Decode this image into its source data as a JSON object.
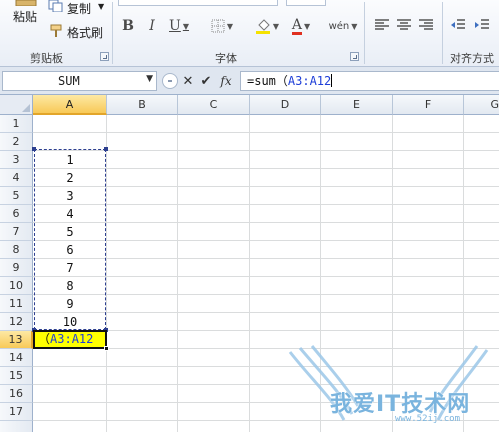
{
  "ribbon": {
    "clipboard": {
      "paste_label": "粘贴",
      "copy_label": "复制",
      "format_painter_label": "格式刷",
      "group_label": "剪贴板"
    },
    "font": {
      "bold": "B",
      "italic": "I",
      "underline": "U",
      "font_color_glyph": "A",
      "phonetic_glyph": "wén",
      "group_label": "字体"
    },
    "alignment": {
      "group_label": "对齐方式"
    }
  },
  "formula_bar": {
    "name_box": "SUM",
    "cancel_glyph": "✕",
    "enter_glyph": "✔",
    "fx_glyph": "fx",
    "formula_prefix": "=sum（",
    "formula_ref": "A3:A12"
  },
  "grid": {
    "columns": [
      "A",
      "B",
      "C",
      "D",
      "E",
      "F",
      "G"
    ],
    "rows": [
      "1",
      "2",
      "3",
      "4",
      "5",
      "6",
      "7",
      "8",
      "9",
      "10",
      "11",
      "12",
      "13",
      "14",
      "15",
      "16",
      "17"
    ],
    "active_column": "A",
    "active_row": "13",
    "cells": [
      "1",
      "2",
      "3",
      "4",
      "5",
      "6",
      "7",
      "8",
      "9",
      "10"
    ],
    "editing_cell_prefix": "（",
    "editing_cell_ref": "A3:A12"
  },
  "watermark": {
    "text": "我爱IT技术网",
    "url": "www.52ij.com"
  },
  "colors": {
    "ribbon_bg": "#e9eef6",
    "header_active": "#f8c958",
    "edit_cell_bg": "#ffff00",
    "reference_blue": "#1f3fd8",
    "marquee": "#2d3f8f"
  }
}
